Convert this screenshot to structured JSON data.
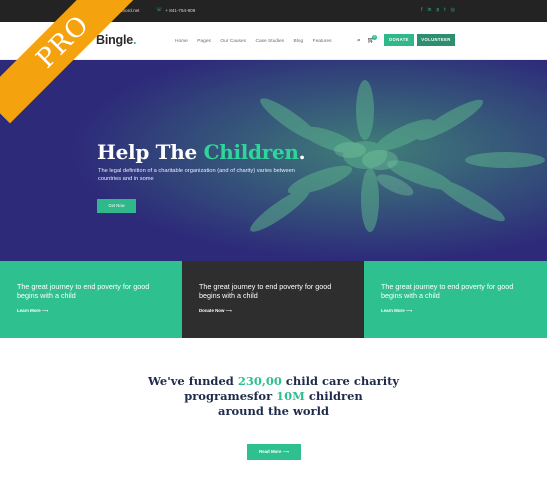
{
  "topbar": {
    "email": "support@anshord.net",
    "phone": "+ 841-754-909",
    "social_icons": [
      "facebook-icon",
      "linkedin-icon",
      "pinterest-icon",
      "twitter-icon",
      "instagram-icon"
    ]
  },
  "header": {
    "logo": "Bingle",
    "logo_dot": ".",
    "nav": [
      "Home",
      "Pages",
      "Our Causes",
      "Case Studies",
      "Blog",
      "Features"
    ],
    "cart_count": "0",
    "donate_label": "DONATE",
    "volunteer_label": "VOLUNTEER"
  },
  "hero": {
    "title_main": "Help The",
    "title_accent": "Children",
    "title_dot": ".",
    "text": "The legal definition of a charitable organization (and of charity) varies between countries and in some",
    "button": "Get Now"
  },
  "cards": [
    {
      "title": "The great journey to end poverty for good begins with a child",
      "link": "Learn More"
    },
    {
      "title": "The great journey to end poverty for good begins with a child",
      "link": "Donate Now"
    },
    {
      "title": "The great journey to end poverty for good begins with a child",
      "link": "Learn More"
    }
  ],
  "funded": {
    "line1_pre": "We've funded ",
    "line1_num": "230,00",
    "line1_post": " child care charity",
    "line2_pre": "programesfor ",
    "line2_num": "10M",
    "line2_post": " children",
    "line3": "around the world",
    "button": "Read More"
  },
  "ribbon": "PRO",
  "colors": {
    "accent": "#2fc08f",
    "hero_bg": "#2d2a7a",
    "dark_card": "#2e2e2e",
    "ribbon": "#f5a20f"
  }
}
